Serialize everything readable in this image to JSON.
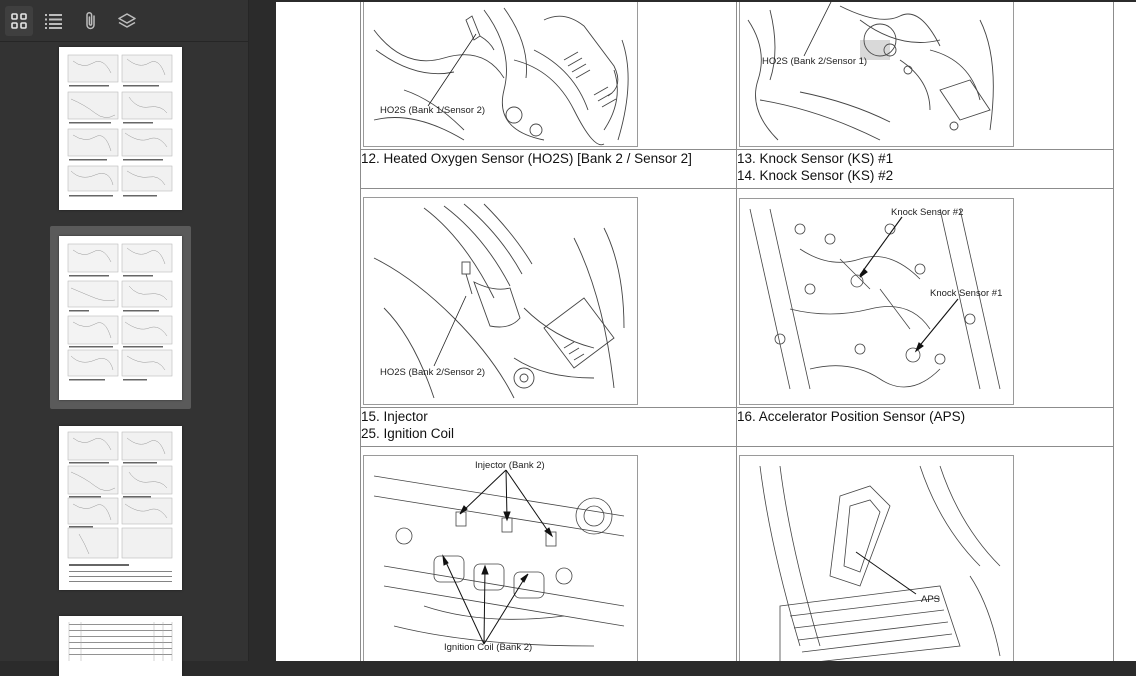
{
  "sidebar": {
    "tools": [
      {
        "name": "thumbnails-view",
        "icon": "grid-icon",
        "active": true
      },
      {
        "name": "outline-view",
        "icon": "list-icon",
        "active": false
      },
      {
        "name": "attachments-view",
        "icon": "paperclip-icon",
        "active": false
      },
      {
        "name": "layers-view",
        "icon": "layers-icon",
        "active": false
      }
    ],
    "selected_thumbnail": 2
  },
  "document": {
    "rows": [
      {
        "left_callout": "HO2S (Bank 1/Sensor 2)",
        "right_callout": "HO2S (Bank 2/Sensor 1)"
      },
      {
        "left_label": "12. Heated Oxygen Sensor (HO2S) [Bank 2 / Sensor 2]",
        "right_label_1": "13. Knock Sensor (KS) #1",
        "right_label_2": "14. Knock Sensor (KS) #2"
      },
      {
        "left_callout": "HO2S (Bank 2/Sensor 2)",
        "right_callout_1": "Knock Sensor #2",
        "right_callout_2": "Knock Sensor #1"
      },
      {
        "left_label_1": "15. Injector",
        "left_label_2": "25. Ignition Coil",
        "right_label": "16. Accelerator Position Sensor (APS)"
      },
      {
        "left_callout_1": "Injector (Bank 2)",
        "left_callout_2": "Ignition Coil (Bank 2)",
        "right_callout": "APS"
      }
    ]
  }
}
